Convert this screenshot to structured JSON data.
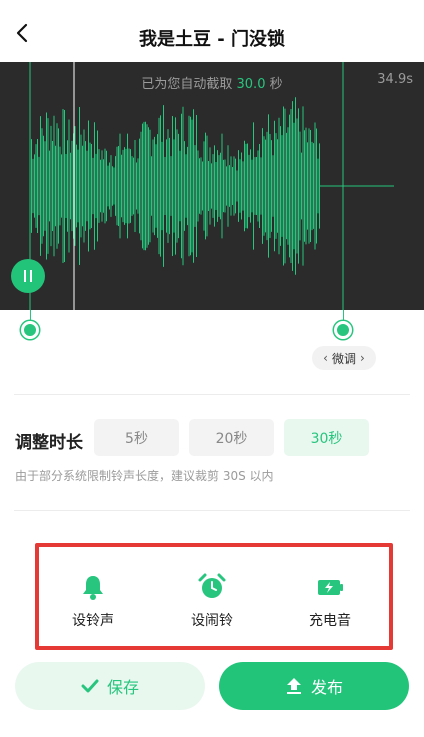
{
  "header": {
    "title": "我是土豆 - 门没锁",
    "back_icon": "chevron-left-icon"
  },
  "waveform": {
    "auto_clip_prefix": "已为您自动截取",
    "auto_clip_seconds": "30.0",
    "auto_clip_suffix": "秒",
    "total_duration": "34.9s",
    "wave_color": "#27c57e",
    "background": "#2b2b2b",
    "playback_state": "paused",
    "fine_tune_label": "微调"
  },
  "duration": {
    "label": "调整时长",
    "options": [
      "5秒",
      "20秒",
      "30秒"
    ],
    "selected": "30秒",
    "hint": "由于部分系统限制铃声长度，建议裁剪 30S 以内"
  },
  "actions": [
    {
      "label": "设铃声",
      "icon": "bell-icon"
    },
    {
      "label": "设闹铃",
      "icon": "alarm-clock-icon"
    },
    {
      "label": "充电音",
      "icon": "battery-charge-icon"
    }
  ],
  "buttons": {
    "save_label": "保存",
    "publish_label": "发布"
  },
  "colors": {
    "accent": "#27c57e",
    "accent_light": "#e9f8ef",
    "highlight_box": "#e53935"
  }
}
